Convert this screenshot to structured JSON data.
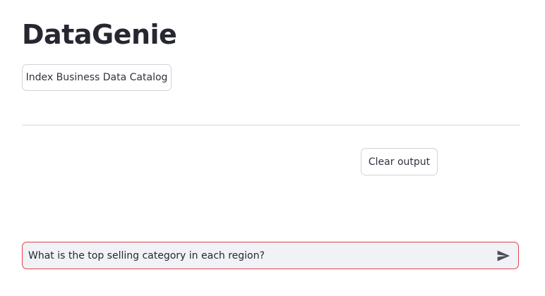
{
  "app": {
    "title": "DataGenie"
  },
  "actions": {
    "index_label": "Index Business Data Catalog",
    "clear_label": "Clear output"
  },
  "chat": {
    "input_value": "What is the top selling category in each region?",
    "send_icon": "send-icon",
    "border_color": "#e0434b",
    "background_color": "#f0f2f6"
  }
}
